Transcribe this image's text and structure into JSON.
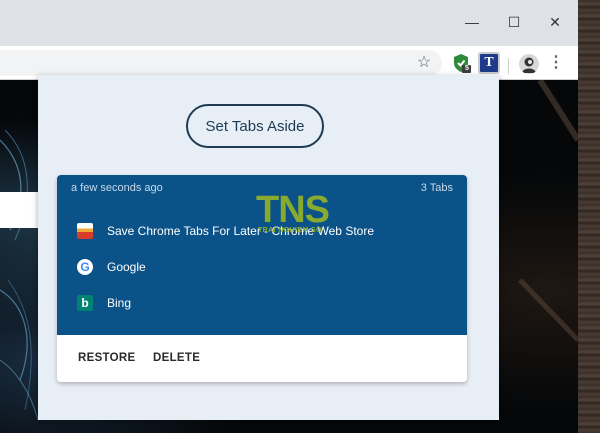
{
  "window": {
    "minimize_glyph": "—",
    "maximize_glyph": "☐",
    "close_glyph": "✕"
  },
  "toolbar": {
    "star_glyph": "☆",
    "extension_t_label": "T",
    "shield_badge": "5",
    "menu_glyph": "⋮"
  },
  "popup": {
    "set_aside_label": "Set Tabs Aside",
    "group": {
      "time": "a few seconds ago",
      "count": "3 Tabs",
      "tabs": [
        {
          "title": "Save Chrome Tabs For Later - Chrome Web Store",
          "icon": "chrome-web-store-icon"
        },
        {
          "title": "Google",
          "icon": "google-icon"
        },
        {
          "title": "Bing",
          "icon": "bing-icon"
        }
      ],
      "actions": {
        "restore": "RESTORE",
        "delete": "DELETE"
      }
    }
  },
  "watermark": {
    "logo": "TNS",
    "sub": "TRAI NGHIEM SO"
  },
  "colors": {
    "card_header": "#0a5288",
    "popup_bg": "#e8eef5",
    "button_border": "#1d3b55"
  }
}
